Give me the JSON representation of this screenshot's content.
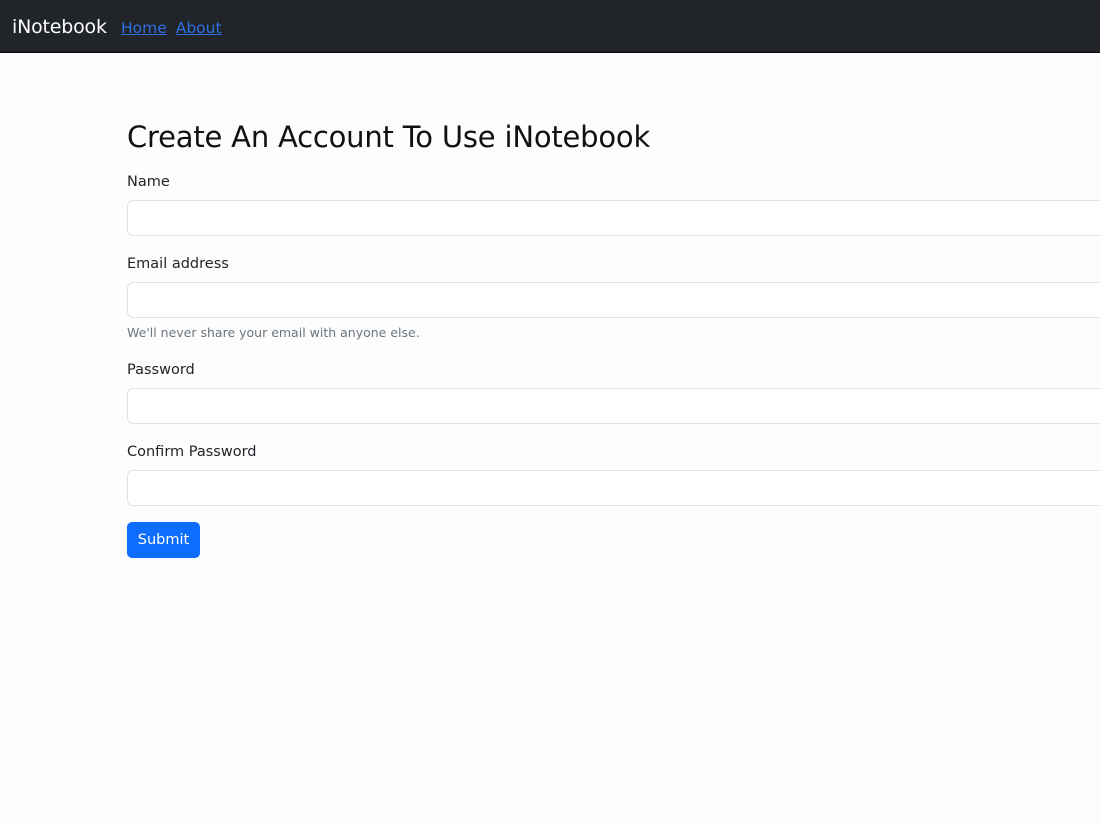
{
  "navbar": {
    "brand": "iNotebook",
    "links": [
      "Home",
      "About"
    ]
  },
  "form": {
    "title": "Create An Account To Use iNotebook",
    "name_label": "Name",
    "name_value": "",
    "email_label": "Email address",
    "email_value": "",
    "email_help": "We'll never share your email with anyone else.",
    "password_label": "Password",
    "password_value": "",
    "confirm_label": "Confirm Password",
    "confirm_value": "",
    "submit_label": "Submit"
  },
  "colors": {
    "navbar_bg": "#212529",
    "link": "#2f6fe3",
    "primary": "#0d6efd",
    "muted": "#6c757d",
    "border": "#dee2e6"
  }
}
